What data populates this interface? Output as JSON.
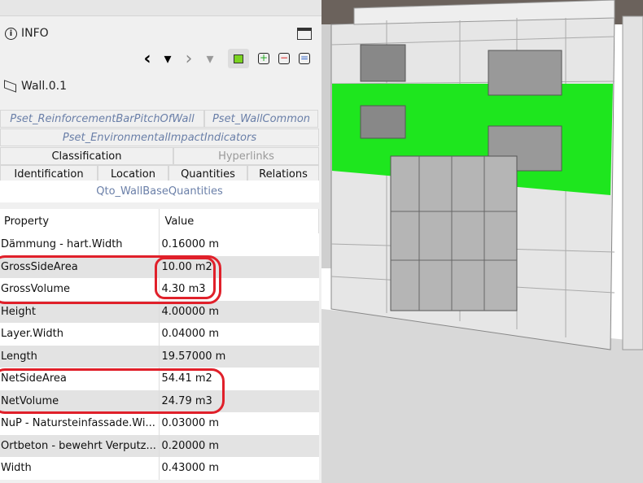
{
  "header": {
    "title": "INFO",
    "element_name": "Wall.0.1"
  },
  "toolbar": {
    "back": "‹",
    "back_menu": "▾",
    "forward": "›",
    "forward_menu": "▾"
  },
  "tabs": {
    "row1": [
      "Pset_ReinforcementBarPitchOfWall",
      "Pset_WallCommon"
    ],
    "row2": [
      "Pset_EnvironmentalImpactIndicators"
    ],
    "row3": [
      "Classification",
      "Hyperlinks"
    ],
    "row4": [
      "Identification",
      "Location",
      "Quantities",
      "Relations"
    ],
    "subtab": "Qto_WallBaseQuantities"
  },
  "table": {
    "headers": [
      "Property",
      "Value"
    ],
    "rows": [
      [
        "Dämmung - hart.Width",
        "0.16000 m"
      ],
      [
        "GrossSideArea",
        "10.00 m2"
      ],
      [
        "GrossVolume",
        "4.30 m3"
      ],
      [
        "Height",
        "4.00000 m"
      ],
      [
        "Layer.Width",
        "0.04000 m"
      ],
      [
        "Length",
        "19.57000 m"
      ],
      [
        "NetSideArea",
        "54.41 m2"
      ],
      [
        "NetVolume",
        "24.79 m3"
      ],
      [
        "NuP - Natursteinfassade.Wi...",
        "0.03000 m"
      ],
      [
        "Ortbeton - bewehrt Verputz...",
        "0.20000 m"
      ],
      [
        "Width",
        "0.43000 m"
      ]
    ]
  },
  "colors": {
    "highlight": "#e0202a",
    "selection": "#1ee61e"
  }
}
